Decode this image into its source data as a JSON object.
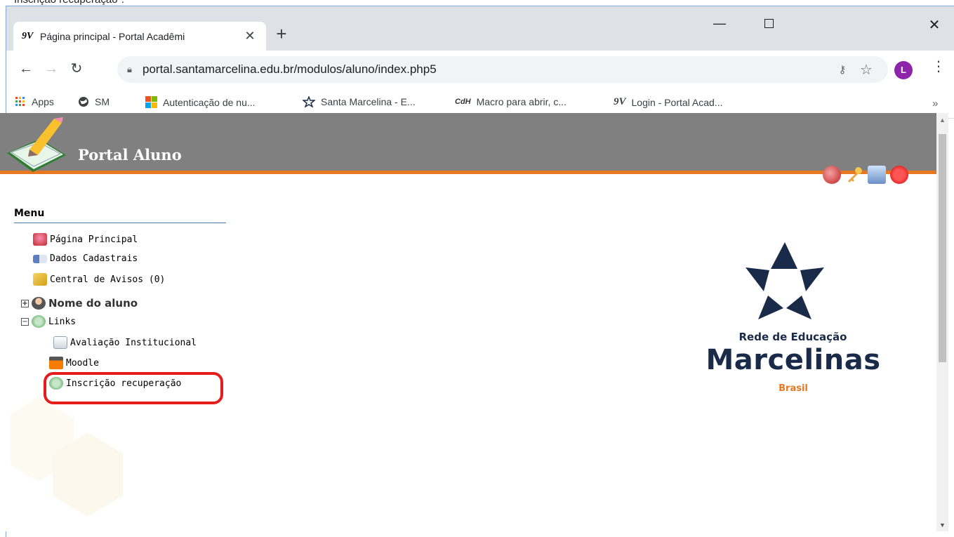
{
  "caption": "Inscrição recuperação\".",
  "browser": {
    "tab_favicon": "9V",
    "tab_title": "Página principal - Portal Acadêmi",
    "tab_close": "✕",
    "new_tab": "+",
    "url": "portal.santamarcelina.edu.br/modulos/aluno/index.php5",
    "profile_initial": "L",
    "window_controls": {
      "minimize": "—",
      "close": "✕"
    }
  },
  "bookmarks": [
    {
      "label": "Apps",
      "icon": "apps-grid-icon"
    },
    {
      "label": "SM",
      "icon": "globe-icon"
    },
    {
      "label": "Autenticação de nu...",
      "icon": "microsoft-icon"
    },
    {
      "label": "Santa Marcelina - E...",
      "icon": "star-outline-icon"
    },
    {
      "label": "Macro para abrir, c...",
      "icon": "cdh-icon"
    },
    {
      "label": "Login - Portal Acad...",
      "icon": "9v-icon"
    }
  ],
  "portal": {
    "title": "Portal Aluno",
    "menu_heading": "Menu",
    "menu": {
      "pagina_principal": "Página Principal",
      "dados_cadastrais": "Dados Cadastrais",
      "central_avisos": "Central de Avisos (0)",
      "nome_aluno": "Nome do aluno",
      "links": "Links",
      "avaliacao": "Avaliação Institucional",
      "moodle": "Moodle",
      "inscricao": "Inscrição recuperação"
    },
    "brand": {
      "subtitle": "Rede de Educação",
      "name": "Marcelinas",
      "country": "Brasil"
    }
  },
  "colors": {
    "header_gray": "#808080",
    "accent_orange": "#e87722",
    "brand_navy": "#1a2b4a",
    "highlight_red": "#e41c1c"
  }
}
